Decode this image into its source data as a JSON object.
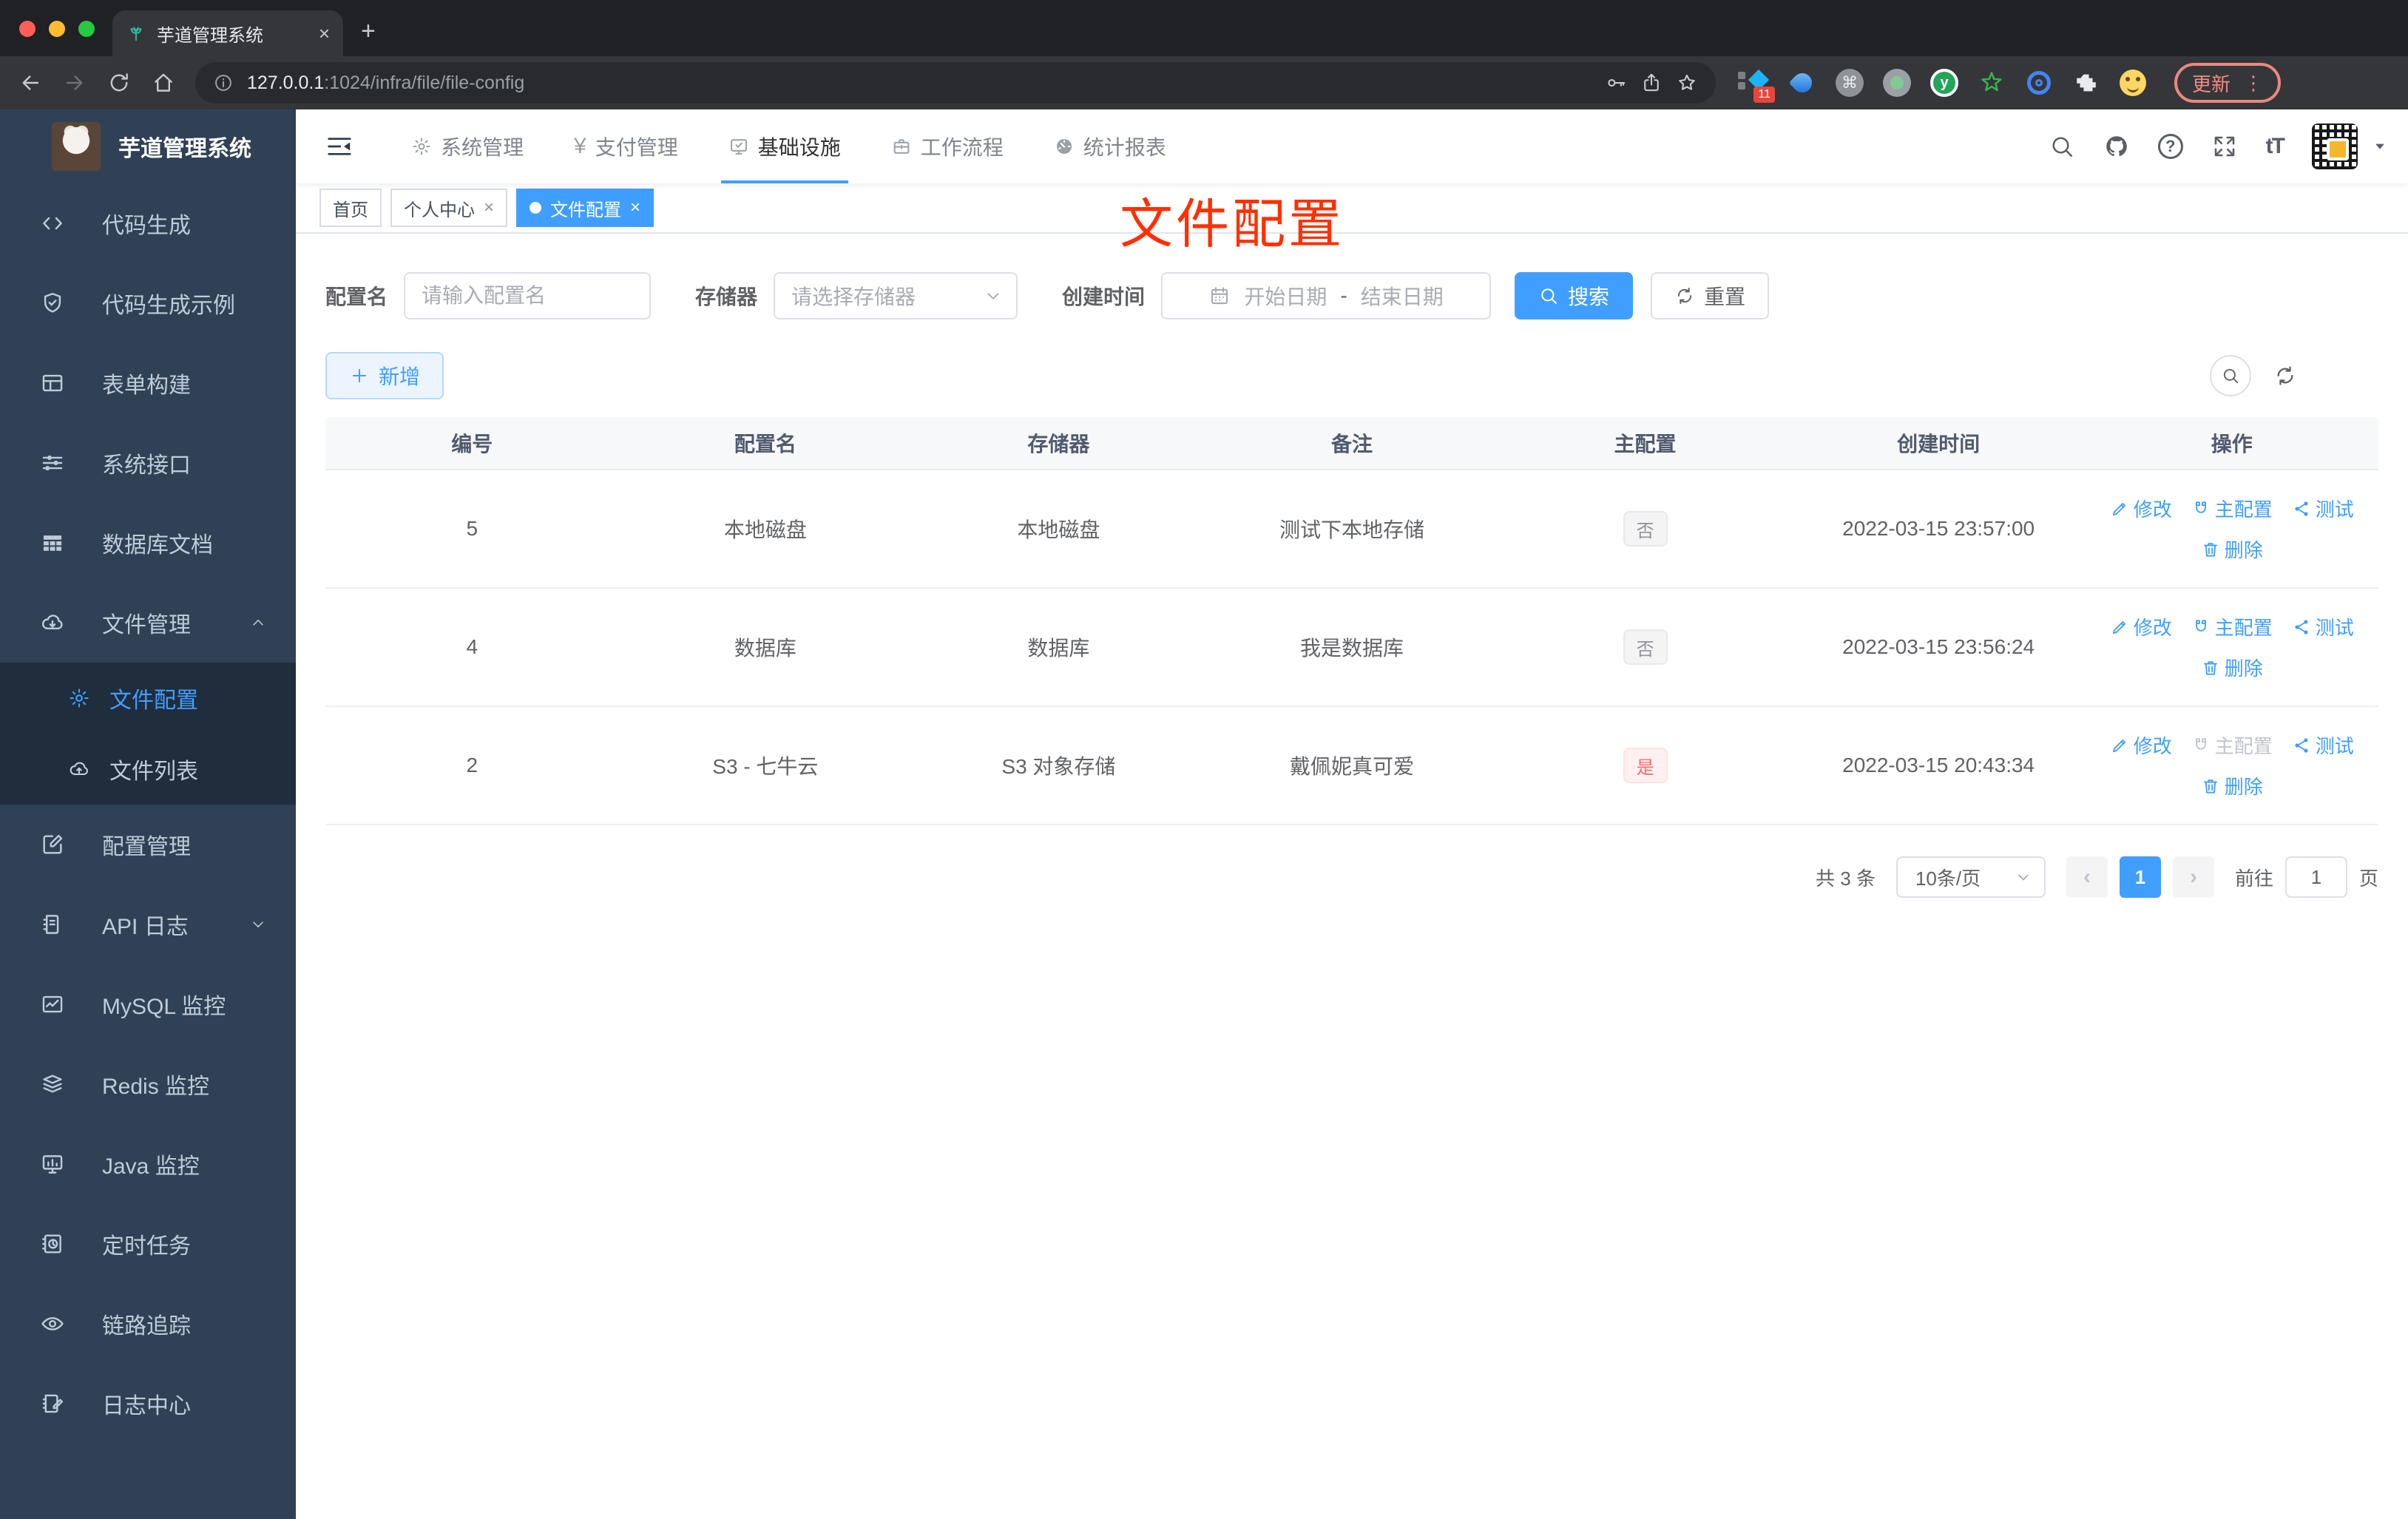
{
  "browser": {
    "tab": {
      "title": "芋道管理系统"
    },
    "url": {
      "host": "127.0.0.1",
      "path": ":1024/infra/file/file-config"
    },
    "extensions": {
      "badge": "11"
    },
    "update_label": "更新"
  },
  "glyphs": {
    "close": "×",
    "plus": "+",
    "yen": "¥",
    "cmd": "⌘",
    "y": "y",
    "question": "?",
    "dots": "⋮",
    "font_size": "tT",
    "prev": "‹",
    "next": "›",
    "puzzle": "▚"
  },
  "sidebar": {
    "title": "芋道管理系统",
    "items": [
      {
        "label": "代码生成",
        "icon": "code-icon"
      },
      {
        "label": "代码生成示例",
        "icon": "shield-check-icon"
      },
      {
        "label": "表单构建",
        "icon": "form-icon"
      },
      {
        "label": "系统接口",
        "icon": "sliders-icon"
      },
      {
        "label": "数据库文档",
        "icon": "grid-icon"
      },
      {
        "label": "文件管理",
        "icon": "cloud-download-icon"
      },
      {
        "label": "文件配置",
        "icon": "gear-icon"
      },
      {
        "label": "文件列表",
        "icon": "cloud-upload-icon"
      },
      {
        "label": "配置管理",
        "icon": "edit-square-icon"
      },
      {
        "label": "API 日志",
        "icon": "doc-edit-icon"
      },
      {
        "label": "MySQL 监控",
        "icon": "chart-icon"
      },
      {
        "label": "Redis 监控",
        "icon": "layers-icon"
      },
      {
        "label": "Java 监控",
        "icon": "monitor-icon"
      },
      {
        "label": "定时任务",
        "icon": "schedule-icon"
      },
      {
        "label": "链路追踪",
        "icon": "eye-icon"
      },
      {
        "label": "日志中心",
        "icon": "log-edit-icon"
      }
    ]
  },
  "topnav": {
    "items": [
      {
        "label": "系统管理"
      },
      {
        "label": "支付管理"
      },
      {
        "label": "基础设施"
      },
      {
        "label": "工作流程"
      },
      {
        "label": "统计报表"
      }
    ]
  },
  "tags": {
    "items": [
      {
        "label": "首页"
      },
      {
        "label": "个人中心"
      },
      {
        "label": "文件配置"
      }
    ]
  },
  "overlay_title": "文件配置",
  "filter": {
    "name_label": "配置名",
    "name_placeholder": "请输入配置名",
    "storage_label": "存储器",
    "storage_placeholder": "请选择存储器",
    "time_label": "创建时间",
    "start_placeholder": "开始日期",
    "range_separator": "-",
    "end_placeholder": "结束日期",
    "search_label": "搜索",
    "reset_label": "重置"
  },
  "toolbar": {
    "add_label": "新增"
  },
  "table": {
    "headers": [
      "编号",
      "配置名",
      "存储器",
      "备注",
      "主配置",
      "创建时间",
      "操作"
    ],
    "action_labels": {
      "edit": "修改",
      "master": "主配置",
      "test": "测试",
      "delete": "删除"
    },
    "rows": [
      {
        "id": "5",
        "name": "本地磁盘",
        "storage": "本地磁盘",
        "remark": "测试下本地存储",
        "master": "否",
        "created": "2022-03-15 23:57:00"
      },
      {
        "id": "4",
        "name": "数据库",
        "storage": "数据库",
        "remark": "我是数据库",
        "master": "否",
        "created": "2022-03-15 23:56:24"
      },
      {
        "id": "2",
        "name": "S3 - 七牛云",
        "storage": "S3 对象存储",
        "remark": "戴佩妮真可爱",
        "master": "是",
        "created": "2022-03-15 20:43:34"
      }
    ]
  },
  "pagination": {
    "total": "共 3 条",
    "page_size": "10条/页",
    "current": "1",
    "goto_label": "前往",
    "goto_value": "1",
    "page_suffix": "页"
  },
  "colors": {
    "accent": "#409eff",
    "danger": "#f56c6c",
    "overlay_red": "#ff3000",
    "sidebar_bg": "#304156",
    "submenu_bg": "#1f2d3d"
  }
}
